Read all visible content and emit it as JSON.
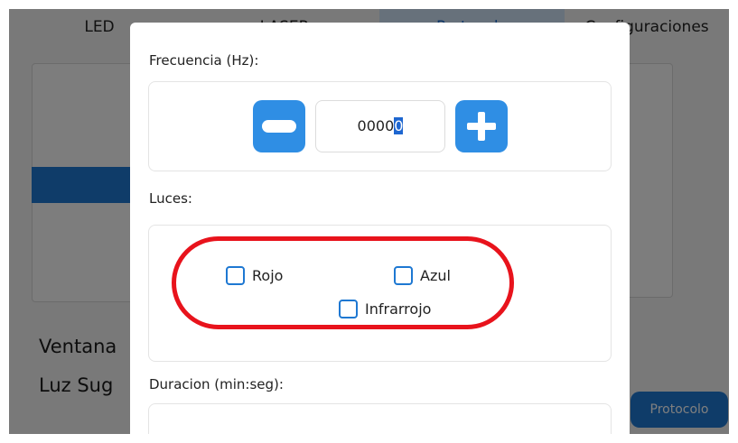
{
  "tabs": [
    {
      "label": "LED"
    },
    {
      "label": "LASER"
    },
    {
      "label": "Protocolo"
    },
    {
      "label": "Configuraciones"
    }
  ],
  "background": {
    "ventana_label": "Ventana",
    "luz_label": "Luz Sug",
    "protocolo_button": "Protocolo"
  },
  "dialog": {
    "frecuencia_label": "Frecuencia (Hz):",
    "frecuencia_value_prefix": "0000",
    "frecuencia_value_selected": "0",
    "luces_label": "Luces:",
    "lights": [
      {
        "label": "Rojo",
        "checked": false
      },
      {
        "label": "Azul",
        "checked": false
      },
      {
        "label": "Infrarrojo",
        "checked": false
      }
    ],
    "duracion_label": "Duracion (min:seg):"
  },
  "colors": {
    "accent": "#2f8ee4",
    "highlight": "#e8131c"
  }
}
